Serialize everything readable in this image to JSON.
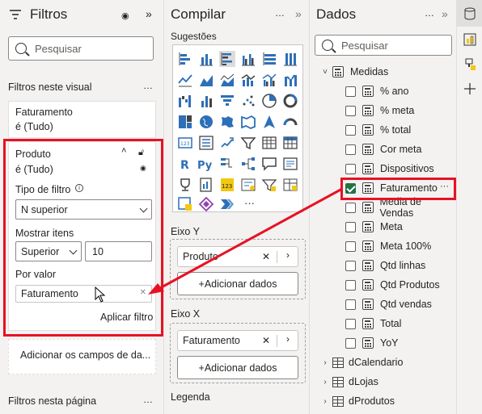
{
  "filters": {
    "title": "Filtros",
    "search_placeholder": "Pesquisar",
    "section_visual": "Filtros neste visual",
    "card1": {
      "field": "Faturamento",
      "state": "é (Tudo)"
    },
    "card2": {
      "field": "Produto",
      "state": "é (Tudo)",
      "filter_type_label": "Tipo de filtro",
      "filter_type_value": "N superior",
      "show_items_label": "Mostrar itens",
      "show_items_mode": "Superior",
      "show_items_count": "10",
      "by_value_label": "Por valor",
      "by_value_field": "Faturamento",
      "apply_label": "Aplicar filtro"
    },
    "add_fields": "Adicionar os campos de da...",
    "section_page": "Filtros nesta página"
  },
  "viz": {
    "title": "Compilar",
    "suggestions_label": "Sugestões",
    "y_axis_label": "Eixo Y",
    "y_field": "Produto",
    "add_data": "+Adicionar dados",
    "x_axis_label": "Eixo X",
    "x_field": "Faturamento",
    "legend_label": "Legenda"
  },
  "data": {
    "title": "Dados",
    "search_placeholder": "Pesquisar",
    "measures_table": "Medidas",
    "measures": [
      "% ano",
      "% meta",
      "% total",
      "Cor meta",
      "Dispositivos",
      "Faturamento",
      "Media de Vendas",
      "Meta",
      "Meta 100%",
      "Qtd linhas",
      "Qtd Produtos",
      "Qtd vendas",
      "Total",
      "YoY"
    ],
    "checked_measure_index": 5,
    "tables": [
      "dCalendario",
      "dLojas",
      "dProdutos"
    ]
  },
  "colors": {
    "highlight_red": "#e81123",
    "check_green": "#217346",
    "viz_blue": "#2e6fb7"
  }
}
